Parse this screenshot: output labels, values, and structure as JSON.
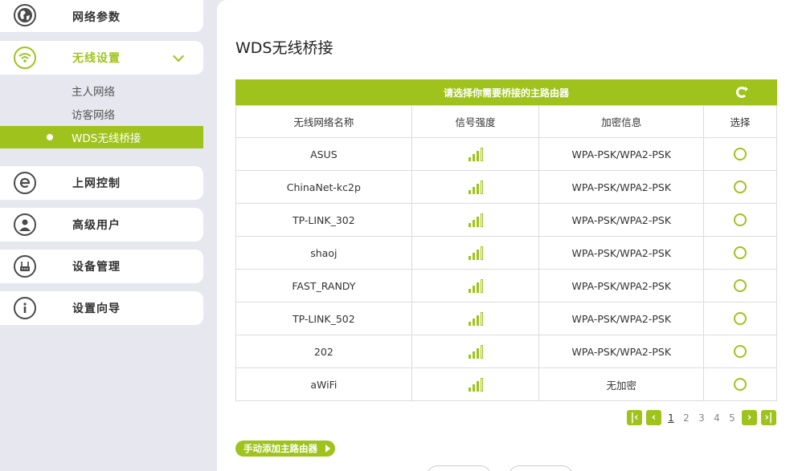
{
  "sidebar": {
    "items": [
      {
        "label": "网络参数",
        "icon": "globe-icon"
      },
      {
        "label": "无线设置",
        "icon": "wifi-icon"
      },
      {
        "label": "上网控制",
        "icon": "internet-e-icon"
      },
      {
        "label": "高级用户",
        "icon": "user-icon"
      },
      {
        "label": "设备管理",
        "icon": "router-icon"
      },
      {
        "label": "设置向导",
        "icon": "info-icon"
      }
    ],
    "sub_items": [
      {
        "label": "主人网络"
      },
      {
        "label": "访客网络"
      },
      {
        "label": "WDS无线桥接"
      }
    ]
  },
  "main": {
    "title": "WDS无线桥接",
    "table_header": "请选择你需要桥接的主路由器",
    "columns": [
      "无线网络名称",
      "信号强度",
      "加密信息",
      "选择"
    ],
    "rows": [
      {
        "name": "ASUS",
        "signal": 4,
        "encryption": "WPA-PSK/WPA2-PSK"
      },
      {
        "name": "ChinaNet-kc2p",
        "signal": 4,
        "encryption": "WPA-PSK/WPA2-PSK"
      },
      {
        "name": "TP-LINK_302",
        "signal": 4,
        "encryption": "WPA-PSK/WPA2-PSK"
      },
      {
        "name": "shaoj",
        "signal": 4,
        "encryption": "WPA-PSK/WPA2-PSK"
      },
      {
        "name": "FAST_RANDY",
        "signal": 4,
        "encryption": "WPA-PSK/WPA2-PSK"
      },
      {
        "name": "TP-LINK_502",
        "signal": 4,
        "encryption": "WPA-PSK/WPA2-PSK"
      },
      {
        "name": "202",
        "signal": 4,
        "encryption": "WPA-PSK/WPA2-PSK"
      },
      {
        "name": "aWiFi",
        "signal": 4,
        "encryption": "无加密"
      }
    ],
    "pagination": {
      "pages": [
        "1",
        "2",
        "3",
        "4",
        "5"
      ],
      "current": "1"
    },
    "add_button_label": "手动添加主路由器"
  },
  "colors": {
    "accent": "#9fc31c",
    "background": "#e6e7ef"
  }
}
